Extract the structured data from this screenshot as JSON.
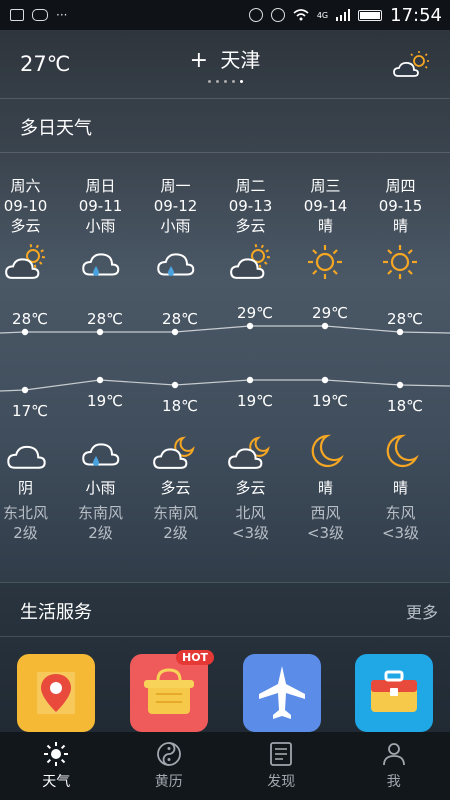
{
  "status": {
    "left_glyphs": "···",
    "network": "4G",
    "time": "17:54"
  },
  "header": {
    "current_temp": "27℃",
    "plus": "+",
    "city": "天津"
  },
  "forecast": {
    "title": "多日天气",
    "days": [
      {
        "weekday": "周六",
        "date": "09-10",
        "day_cond": "多云",
        "day_icon": "partly-cloudy-icon",
        "high": "28℃",
        "low": "17℃",
        "night_icon": "cloudy-icon",
        "night_cond": "阴",
        "wind_dir": "东北风",
        "wind_lvl": "2级"
      },
      {
        "weekday": "周日",
        "date": "09-11",
        "day_cond": "小雨",
        "day_icon": "rain-icon",
        "high": "28℃",
        "low": "19℃",
        "night_icon": "rain-icon",
        "night_cond": "小雨",
        "wind_dir": "东南风",
        "wind_lvl": "2级"
      },
      {
        "weekday": "周一",
        "date": "09-12",
        "day_cond": "小雨",
        "day_icon": "rain-icon",
        "high": "28℃",
        "low": "18℃",
        "night_icon": "cloudy-moon-icon",
        "night_cond": "多云",
        "wind_dir": "东南风",
        "wind_lvl": "2级"
      },
      {
        "weekday": "周二",
        "date": "09-13",
        "day_cond": "多云",
        "day_icon": "partly-cloudy-icon",
        "high": "29℃",
        "low": "19℃",
        "night_icon": "cloudy-moon-icon",
        "night_cond": "多云",
        "wind_dir": "北风",
        "wind_lvl": "<3级"
      },
      {
        "weekday": "周三",
        "date": "09-14",
        "day_cond": "晴",
        "day_icon": "sun-icon",
        "high": "29℃",
        "low": "19℃",
        "night_icon": "moon-icon",
        "night_cond": "晴",
        "wind_dir": "西风",
        "wind_lvl": "<3级"
      },
      {
        "weekday": "周四",
        "date": "09-15",
        "day_cond": "晴",
        "day_icon": "sun-icon",
        "high": "28℃",
        "low": "18℃",
        "night_icon": "moon-icon",
        "night_cond": "晴",
        "wind_dir": "东风",
        "wind_lvl": "<3级"
      }
    ]
  },
  "services": {
    "title": "生活服务",
    "more": "更多",
    "hot_badge": "HOT",
    "items": [
      {
        "icon": "map-pin-icon",
        "color": "#f5b935"
      },
      {
        "icon": "shopping-basket-icon",
        "color": "#ef5b5b"
      },
      {
        "icon": "airplane-icon",
        "color": "#5b8de8"
      },
      {
        "icon": "briefcase-icon",
        "color": "#1fa7e6"
      }
    ]
  },
  "tabs": [
    {
      "label": "天气",
      "icon": "sun-icon",
      "active": true
    },
    {
      "label": "黄历",
      "icon": "yin-yang-icon",
      "active": false
    },
    {
      "label": "发现",
      "icon": "news-icon",
      "active": false
    },
    {
      "label": "我",
      "icon": "person-icon",
      "active": false
    }
  ],
  "colors": {
    "accent_sun": "#f5a623",
    "rain_drop": "#4aa3df"
  }
}
